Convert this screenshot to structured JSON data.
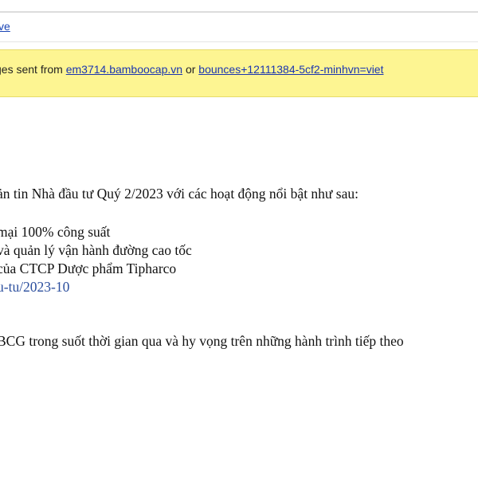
{
  "header": {
    "archive_link": "ve"
  },
  "warning": {
    "prefix": "ges sent from",
    "sender_domain": "em3714.bamboocap.vn",
    "connector": "or",
    "bounce_address": "bounces+12111384-5cf2-minhvn=viet"
  },
  "body": {
    "intro": "ản tin Nhà đầu tư Quý 2/2023 với các hoạt động nổi bật như sau:",
    "bullets": [
      "mại 100% công suất",
      "và quản lý vận hành đường cao tốc",
      "của CTCP Dược phẩm Tipharco"
    ],
    "link_text": "u-tu/2023-10",
    "closing": "BCG trong suốt thời gian qua và hy vọng trên những hành trình tiếp theo"
  }
}
